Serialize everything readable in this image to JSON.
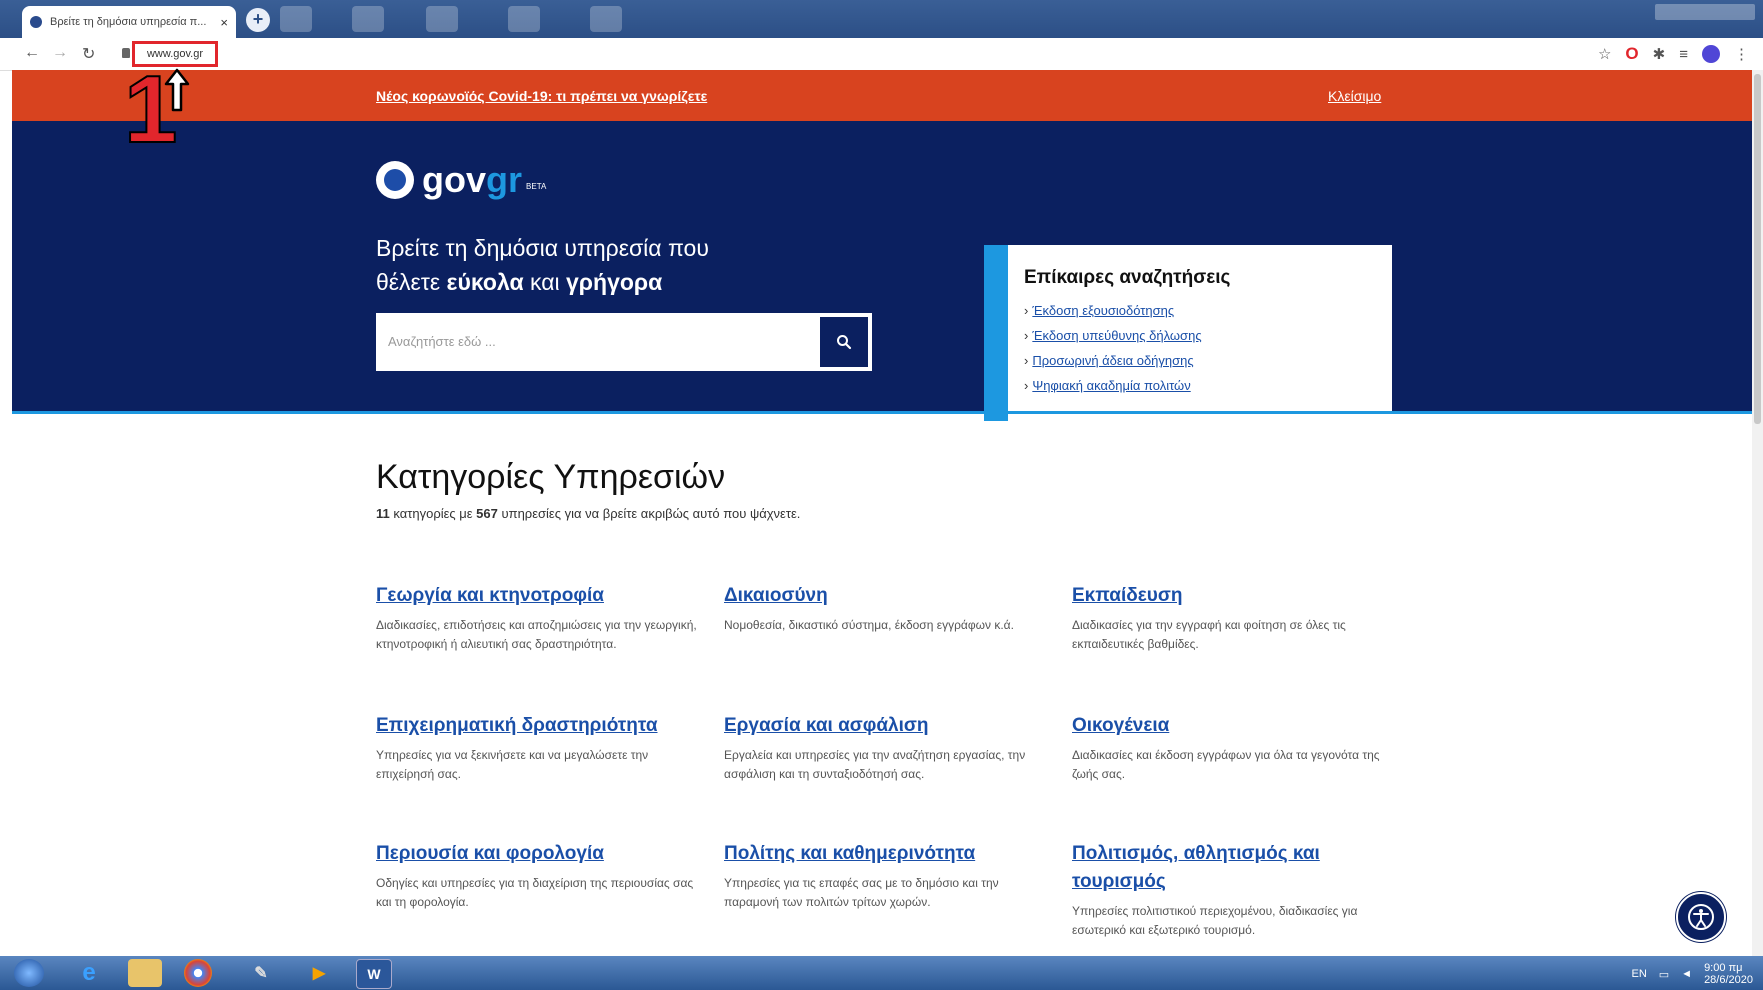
{
  "browser": {
    "tab_title": "Βρείτε τη δημόσια υπηρεσία π...",
    "tab_close": "×",
    "new_tab": "+",
    "url": "www.gov.gr"
  },
  "annotation": {
    "number": "1"
  },
  "banner": {
    "covid_link": "Νέος κορωνοϊός Covid-19: τι πρέπει να γνωρίζετε",
    "close_link": "Κλείσιμο"
  },
  "hero": {
    "logo_gov": "gov",
    "logo_gr": "gr",
    "logo_beta": "BETA",
    "headline_line1": "Βρείτε τη δημόσια υπηρεσία που",
    "headline_pre": "θέλετε ",
    "headline_bold1": "εύκολα",
    "headline_mid": " και ",
    "headline_bold2": "γρήγορα",
    "search_placeholder": "Αναζητήστε εδώ ..."
  },
  "trending": {
    "title": "Επίκαιρες αναζητήσεις",
    "items": [
      "Έκδοση εξουσιοδότησης",
      "Έκδοση υπεύθυνης δήλωσης",
      "Προσωρινή άδεια οδήγησης",
      "Ψηφιακή ακαδημία πολιτών"
    ]
  },
  "services": {
    "title": "Κατηγορίες Υπηρεσιών",
    "subtitle_count": "11",
    "subtitle_mid": " κατηγορίες με ",
    "subtitle_services": "567",
    "subtitle_end": " υπηρεσίες για να βρείτε ακριβώς αυτό που ψάχνετε.",
    "categories": [
      {
        "title": "Γεωργία και κτηνοτροφία",
        "desc": "Διαδικασίες, επιδοτήσεις και αποζημιώσεις για την γεωργική, κτηνοτροφική ή αλιευτική σας δραστηριότητα."
      },
      {
        "title": "Δικαιοσύνη",
        "desc": "Νομοθεσία, δικαστικό σύστημα, έκδοση εγγράφων κ.ά."
      },
      {
        "title": "Εκπαίδευση",
        "desc": "Διαδικασίες για την εγγραφή και φοίτηση σε όλες τις εκπαιδευτικές βαθμίδες."
      },
      {
        "title": "Επιχειρηματική δραστηριότητα",
        "desc": "Υπηρεσίες για να ξεκινήσετε και να μεγαλώσετε την επιχείρησή σας."
      },
      {
        "title": "Εργασία και ασφάλιση",
        "desc": "Εργαλεία και υπηρεσίες για την αναζήτηση εργασίας, την ασφάλιση και τη συνταξιοδότησή σας."
      },
      {
        "title": "Οικογένεια",
        "desc": "Διαδικασίες και έκδοση εγγράφων για όλα τα γεγονότα της ζωής σας."
      },
      {
        "title": "Περιουσία και φορολογία",
        "desc": "Οδηγίες και υπηρεσίες για τη διαχείριση της περιουσίας σας και τη φορολογία."
      },
      {
        "title": "Πολίτης και καθημερινότητα",
        "desc": "Υπηρεσίες για τις επαφές σας με το δημόσιο και την παραμονή των πολιτών τρίτων χωρών."
      },
      {
        "title": "Πολιτισμός, αθλητισμός και τουρισμός",
        "desc": "Υπηρεσίες πολιτιστικού περιεχομένου, διαδικασίες για εσωτερικό και εξωτερικό τουρισμό."
      }
    ]
  },
  "taskbar": {
    "lang": "EN",
    "time": "9:00 πμ",
    "date": "28/6/2020"
  },
  "colors": {
    "banner": "#d8431f",
    "hero": "#0b2060",
    "accent": "#1d98e0",
    "link": "#1a4fa8",
    "annotation": "#e1262c"
  }
}
